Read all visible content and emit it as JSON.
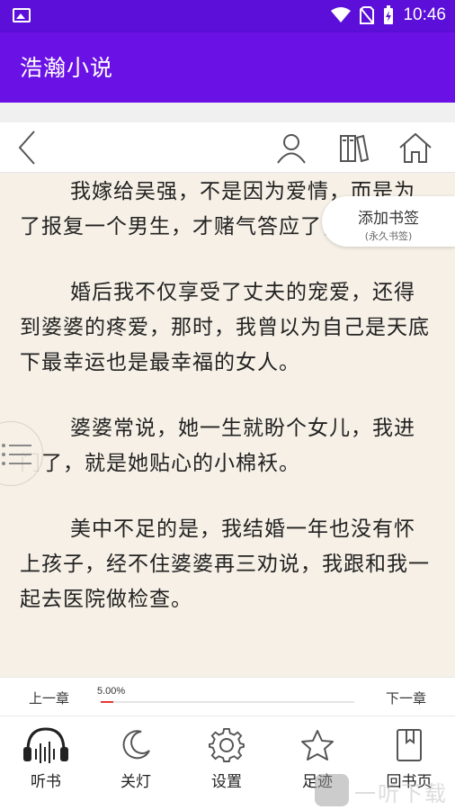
{
  "status_bar": {
    "time": "10:46"
  },
  "app_bar": {
    "title": "浩瀚小说"
  },
  "reader": {
    "paragraphs": [
      "我嫁给吴强，不是因为爱情，而是为了报复一个男生，才赌气答应了他的求婚。",
      "婚后我不仅享受了丈夫的宠爱，还得到婆婆的疼爱，那时，我曾以为自己是天底下最幸运也是最幸福的女人。",
      "婆婆常说，她一生就盼个女儿，我进门了，就是她贴心的小棉袄。",
      "美中不足的是，我结婚一年也没有怀上孩子，经不住婆婆再三劝说，我跟和我一起去医院做检查。"
    ],
    "bookmark": {
      "label": "添加书签",
      "sublabel": "(永久书签)"
    }
  },
  "progress": {
    "prev_label": "上一章",
    "next_label": "下一章",
    "percent_text": "5.00%",
    "fraction": 0.05,
    "fill_color": "#e53935"
  },
  "bottom_nav": [
    {
      "label": "听书",
      "icon": "headphones-icon"
    },
    {
      "label": "关灯",
      "icon": "moon-icon"
    },
    {
      "label": "设置",
      "icon": "gear-icon"
    },
    {
      "label": "足迹",
      "icon": "star-icon"
    },
    {
      "label": "回书页",
      "icon": "book-icon"
    }
  ],
  "watermark": {
    "text": "一听下载",
    "badge": "听"
  },
  "colors": {
    "status_bar": "#5b0fd8",
    "app_bar": "#6a11e6",
    "reader_bg": "#f6f0e6"
  }
}
